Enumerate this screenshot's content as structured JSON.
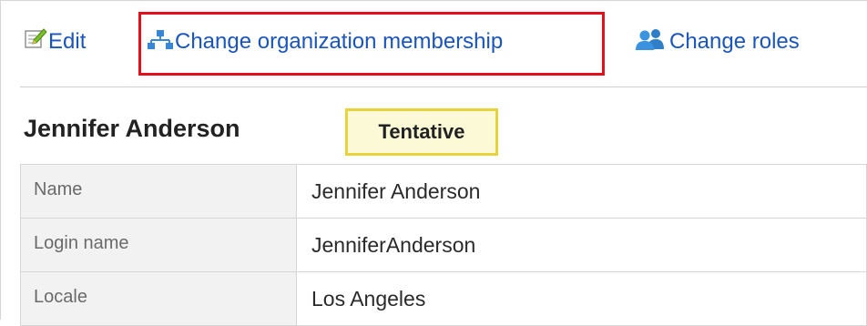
{
  "toolbar": {
    "edit_label": "Edit",
    "edit_icon": "edit-icon",
    "org_label": "Change organization membership",
    "org_icon": "organization-icon",
    "roles_label": "Change roles",
    "roles_icon": "users-icon"
  },
  "colors": {
    "link": "#1a55bd",
    "highlight_border": "#e2101c",
    "badge_border": "#e8d43a",
    "badge_bg": "#fcfad6",
    "key_cell_bg": "#f2f2f2"
  },
  "user": {
    "name": "Jennifer Anderson",
    "status": "Tentative"
  },
  "details": [
    {
      "label": "Name",
      "value": "Jennifer Anderson"
    },
    {
      "label": "Login name",
      "value": "JenniferAnderson"
    },
    {
      "label": "Locale",
      "value": "Los Angeles"
    }
  ]
}
